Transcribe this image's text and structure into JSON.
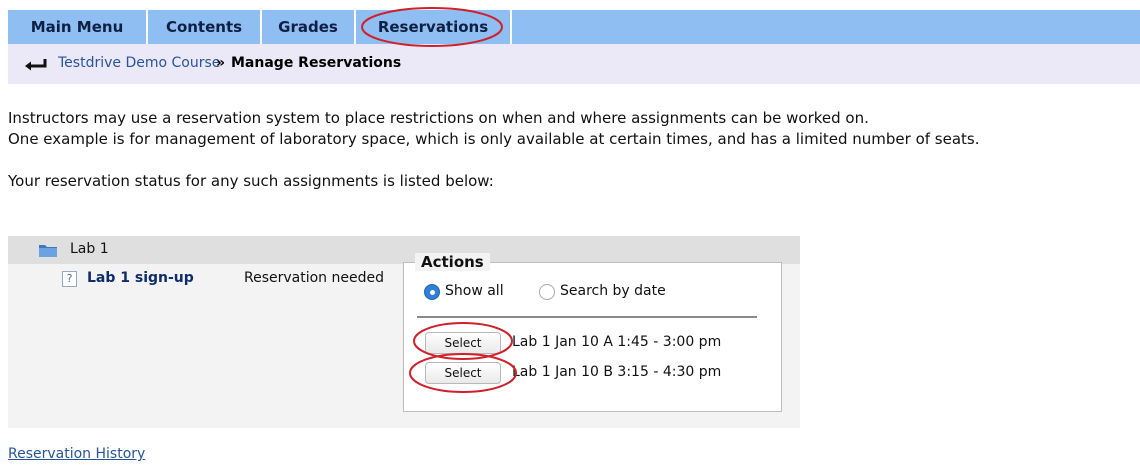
{
  "tabs": [
    {
      "label": "Main Menu"
    },
    {
      "label": "Contents"
    },
    {
      "label": "Grades"
    },
    {
      "label": "Reservations"
    }
  ],
  "breadcrumb": {
    "course_link": "Testdrive Demo Course",
    "separator": "»",
    "current": "Manage Reservations"
  },
  "intro": {
    "line1": "Instructors may use a reservation system to place restrictions on when and where assignments can be worked on.",
    "line2": "One example is for management of laboratory space, which is only available at certain times, and has a limited number of seats.",
    "line3": "Your reservation status for any such assignments is listed below:"
  },
  "reservations": {
    "group_title": "Lab 1",
    "item": {
      "help_glyph": "?",
      "name": "Lab 1 sign-up",
      "status": "Reservation needed"
    },
    "actions": {
      "legend": "Actions",
      "radio_options": [
        {
          "label": "Show all",
          "checked": true
        },
        {
          "label": "Search by date",
          "checked": false
        }
      ],
      "slots": [
        {
          "button_label": "Select",
          "description": "Lab 1 Jan 10 A 1:45 - 3:00 pm"
        },
        {
          "button_label": "Select",
          "description": "Lab 1 Jan 10 B 3:15 - 4:30 pm"
        }
      ]
    }
  },
  "footer": {
    "history_link": "Reservation History"
  },
  "icons": {
    "breadcrumb_arrow": "return-arrow-icon",
    "folder": "folder-icon",
    "help": "help-icon"
  },
  "colors": {
    "tab_bar": "#8fbef3",
    "breadcrumb_bar": "#ebe8f7",
    "link": "#27549c",
    "annotation": "#d0202a",
    "radio_selected": "#2f7fd6"
  }
}
